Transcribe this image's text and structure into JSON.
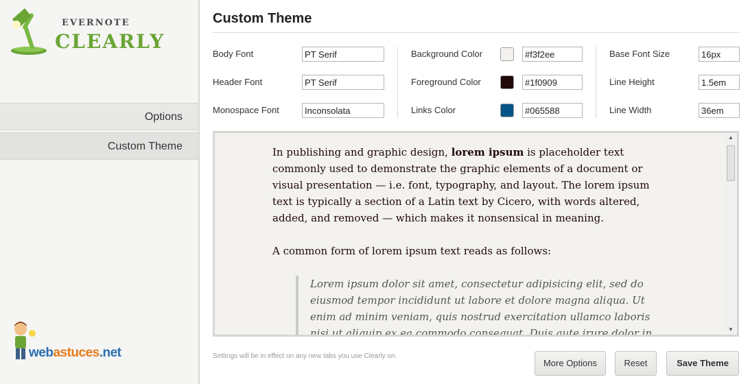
{
  "logo": {
    "top": "EVERNOTE",
    "bottom": "CLEARLY"
  },
  "sidebar": {
    "items": [
      {
        "label": "Options"
      },
      {
        "label": "Custom Theme"
      }
    ]
  },
  "watermark": {
    "part1": "web",
    "part2": "astuces",
    "part3": ".net"
  },
  "page": {
    "title": "Custom Theme"
  },
  "settings": {
    "body_font": {
      "label": "Body Font",
      "value": "PT Serif"
    },
    "header_font": {
      "label": "Header Font",
      "value": "PT Serif"
    },
    "monospace_font": {
      "label": "Monospace Font",
      "value": "Inconsolata"
    },
    "background_color": {
      "label": "Background Color",
      "value": "#f3f2ee",
      "swatch": "#f3f2ee"
    },
    "foreground_color": {
      "label": "Foreground Color",
      "value": "#1f0909",
      "swatch": "#1f0909"
    },
    "links_color": {
      "label": "Links Color",
      "value": "#065588",
      "swatch": "#065588"
    },
    "base_font_size": {
      "label": "Base Font Size",
      "value": "16px"
    },
    "line_height": {
      "label": "Line Height",
      "value": "1.5em"
    },
    "line_width": {
      "label": "Line Width",
      "value": "36em"
    }
  },
  "preview": {
    "p1_before": "In publishing and graphic design, ",
    "p1_bold": "lorem ipsum",
    "p1_after": " is placeholder text commonly used to demonstrate the graphic elements of a document or visual presentation — i.e. font, typography, and layout. The lorem ipsum text is typically a section of a Latin text by Cicero, with words altered, added, and removed — which makes it nonsensical in meaning.",
    "p2": "A common form of lorem ipsum text reads as follows:",
    "quote": "Lorem ipsum dolor sit amet, consectetur adipisicing elit, sed do eiusmod tempor incididunt ut labore et dolore magna aliqua. Ut enim ad minim veniam, quis nostrud exercitation ullamco laboris nisi ut aliquip ex ea commodo consequat. Duis aute irure dolor in reprehenderit in voluptate velit"
  },
  "footer": {
    "note": "Settings will be in effect on any new tabs you use Clearly on.",
    "more_options": "More Options",
    "reset": "Reset",
    "save_theme": "Save Theme"
  },
  "colors": {
    "accent_green": "#6aa536",
    "sidebar_bg": "#f5f5f3"
  }
}
